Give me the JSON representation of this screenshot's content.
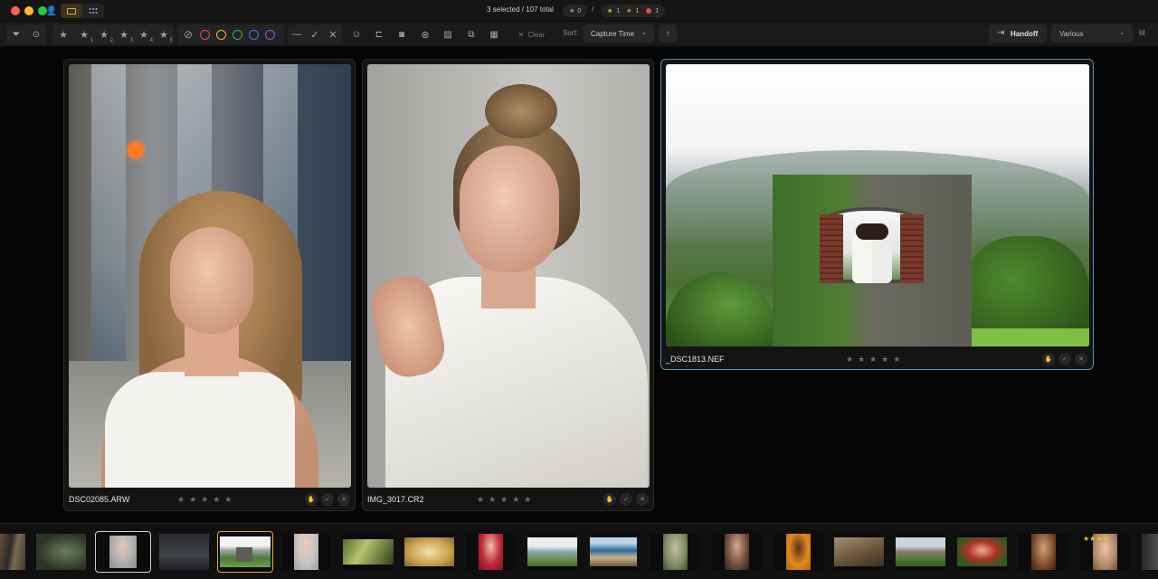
{
  "titlebar": {
    "selection_text": "3 selected / 107 total",
    "counts": {
      "stars_zero": "0",
      "separator": "/",
      "picked": "1",
      "rejected_star": "1",
      "red_label": "1"
    }
  },
  "toolbar": {
    "star_filters": [
      "",
      "1",
      "2",
      "3",
      "4",
      "5"
    ],
    "color_labels": [
      "#e14b4b",
      "#e6b43a",
      "#35b34a",
      "#3e7bd6",
      "#9a54d2"
    ],
    "clear_label": "Clear",
    "sort_label": "Sort:",
    "sort_value": "Capture Time",
    "handoff_label": "Handoff",
    "various_value": "Various"
  },
  "cards": [
    {
      "filename": "DSC02085.ARW",
      "stars": "★★★★★",
      "selected": false
    },
    {
      "filename": "IMG_3017.CR2",
      "stars": "★★★★★",
      "selected": false
    },
    {
      "filename": "_DSC1813.NEF",
      "stars": "★★★★★",
      "selected": true
    }
  ],
  "filmstrip": {
    "stars_badge": "★★★★"
  },
  "colors": {
    "accent": "#e0a43a",
    "selection_border": "#5b8fb3"
  }
}
